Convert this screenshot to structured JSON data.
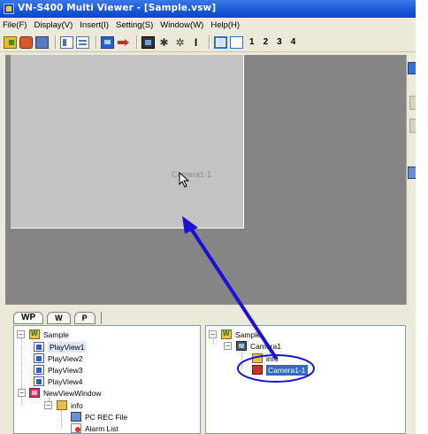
{
  "window": {
    "title": "VN-S400 Multi Viewer - [Sample.vsw]"
  },
  "menu": [
    {
      "label": "File(F)"
    },
    {
      "label": "Display(V)"
    },
    {
      "label": "Insert(I)"
    },
    {
      "label": "Setting(S)"
    },
    {
      "label": "Window(W)"
    },
    {
      "label": "Help(H)"
    }
  ],
  "toolbar": {
    "icons": [
      "open-icon",
      "settings-icon",
      "save-icon",
      "split-view-icon",
      "list-view-icon",
      "monitor-icon",
      "arrow-icon",
      "film-icon",
      "star-icon",
      "cursor-tool-icon",
      "layout-single-icon",
      "layout-quad-icon"
    ],
    "numbers": [
      "1",
      "2",
      "3",
      "4"
    ]
  },
  "main_view": {
    "camera_label": "Camera1-1"
  },
  "tabs": [
    {
      "label": "WP",
      "active": true
    },
    {
      "label": "W",
      "active": false
    },
    {
      "label": "P",
      "active": false
    }
  ],
  "left_tree": {
    "items": [
      {
        "label": "Sample",
        "icon": "workspace-folder-icon"
      },
      {
        "label": "PlayView1",
        "icon": "play-view-icon"
      },
      {
        "label": "PlayView2",
        "icon": "play-view-icon"
      },
      {
        "label": "PlayView3",
        "icon": "play-view-icon"
      },
      {
        "label": "PlayView4",
        "icon": "play-view-icon"
      },
      {
        "label": "NewViewWindow",
        "icon": "view-window-icon"
      },
      {
        "label": "info",
        "icon": "info-folder-icon"
      },
      {
        "label": "PC REC File",
        "icon": "pc-rec-file-icon"
      },
      {
        "label": "Alarm List",
        "icon": "alarm-list-icon"
      }
    ]
  },
  "right_tree": {
    "items": [
      {
        "label": "Sample",
        "icon": "workspace-folder-icon"
      },
      {
        "label": "Camera1",
        "icon": "camera-icon"
      },
      {
        "label": "info",
        "icon": "info-icon"
      },
      {
        "label": "Camera1-1",
        "icon": "camera-item-icon",
        "selected": true
      }
    ]
  },
  "annotations": {
    "arrow_color": "#1A10D8",
    "highlight_color": "#1A10D8"
  }
}
